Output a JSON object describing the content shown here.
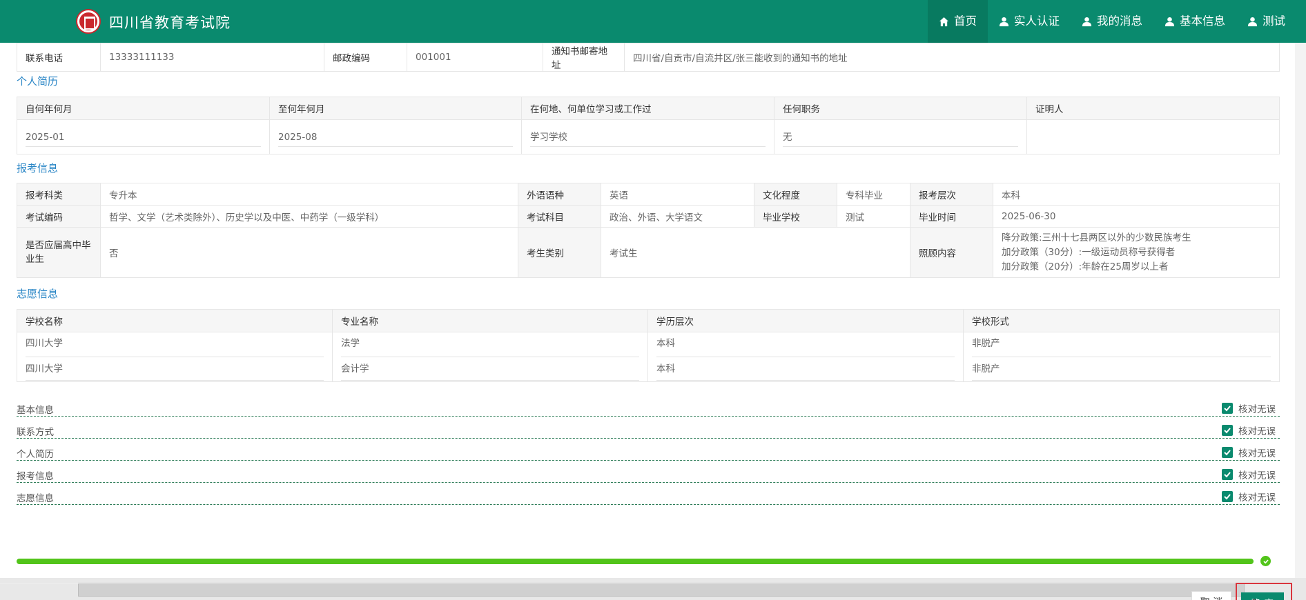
{
  "header": {
    "site_title": "四川省教育考试院",
    "nav": [
      {
        "label": "首页",
        "icon": "home-icon"
      },
      {
        "label": "实人认证",
        "icon": "user-icon"
      },
      {
        "label": "我的消息",
        "icon": "user-icon"
      },
      {
        "label": "基本信息",
        "icon": "user-icon"
      },
      {
        "label": "测试",
        "icon": "user-icon"
      }
    ]
  },
  "contact": {
    "phone_label": "联系电话",
    "phone": "13333111133",
    "zip_label": "邮政编码",
    "zip": "001001",
    "addr_label": "通知书邮寄地址",
    "addr": "四川省/自贡市/自流井区/张三能收到的通知书的地址"
  },
  "resume": {
    "title": "个人简历",
    "headers": [
      "自何年何月",
      "至何年何月",
      "在何地、何单位学习或工作过",
      "任何职务",
      "证明人"
    ],
    "row": [
      "2025-01",
      "2025-08",
      "学习学校",
      "无",
      ""
    ]
  },
  "exam": {
    "title": "报考信息",
    "r1": {
      "a_label": "报考科类",
      "a": "专升本",
      "b_label": "外语语种",
      "b": "英语",
      "c_label": "文化程度",
      "c": "专科毕业",
      "d_label": "报考层次",
      "d": "本科"
    },
    "r2": {
      "a_label": "考试编码",
      "a": "哲学、文学（艺术类除外）、历史学以及中医、中药学（一级学科）",
      "b_label": "考试科目",
      "b": "政治、外语、大学语文",
      "c_label": "毕业学校",
      "c": "测试",
      "d_label": "毕业时间",
      "d": "2025-06-30"
    },
    "r3": {
      "a_label": "是否应届高中毕业生",
      "a": "否",
      "b_label": "考生类别",
      "b": "考试生",
      "c_label": "照顾内容",
      "c1": "降分政策:三州十七县两区以外的少数民族考生",
      "c2": "加分政策（30分）:一级运动员称号获得者",
      "c3": "加分政策（20分）:年龄在25周岁以上者"
    }
  },
  "wish": {
    "title": "志愿信息",
    "headers": [
      "学校名称",
      "专业名称",
      "学历层次",
      "学校形式"
    ],
    "rows": [
      [
        "四川大学",
        "法学",
        "本科",
        "非脱产"
      ],
      [
        "四川大学",
        "会计学",
        "本科",
        "非脱产"
      ]
    ]
  },
  "checks": {
    "ok_label": "核对无误",
    "items": [
      "基本信息",
      "联系方式",
      "个人简历",
      "报考信息",
      "志愿信息"
    ]
  },
  "progress": {
    "percent": 100
  },
  "footer": {
    "cancel": "取 消",
    "confirm": "确 定"
  },
  "colors": {
    "primary": "#0a8a6e",
    "progress": "#52c41a",
    "section_title": "#2a86c6",
    "highlight": "#d9363e"
  }
}
